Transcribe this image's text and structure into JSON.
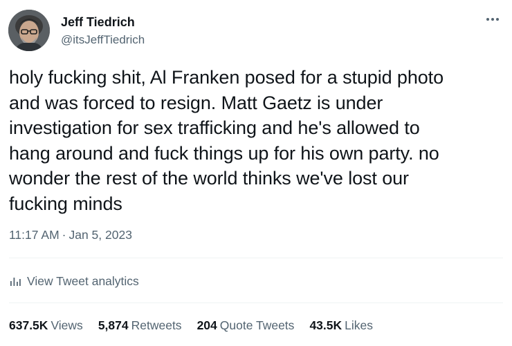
{
  "author": {
    "name": "Jeff Tiedrich",
    "handle": "@itsJeffTiedrich"
  },
  "tweet": {
    "text": "holy fucking shit, Al Franken posed for a stupid photo\nand was forced to resign. Matt Gaetz is under\ninvestigation for sex trafficking and he's allowed to\nhang around and fuck things up for his own party. no\nwonder the rest of the world thinks we've lost our\nfucking minds",
    "time": "11:17 AM",
    "separator": "·",
    "date": "Jan 5, 2023"
  },
  "analytics": {
    "label": "View Tweet analytics",
    "icon": "bar-chart-icon"
  },
  "stats": {
    "views": {
      "value": "637.5K",
      "label": "Views"
    },
    "retweets": {
      "value": "5,874",
      "label": "Retweets"
    },
    "quotes": {
      "value": "204",
      "label": "Quote Tweets"
    },
    "likes": {
      "value": "43.5K",
      "label": "Likes"
    }
  },
  "icons": {
    "more": "more-horizontal-icon",
    "avatar": "avatar"
  },
  "colors": {
    "primary_text": "#0f1419",
    "secondary_text": "#536471",
    "divider": "#eff3f4"
  }
}
